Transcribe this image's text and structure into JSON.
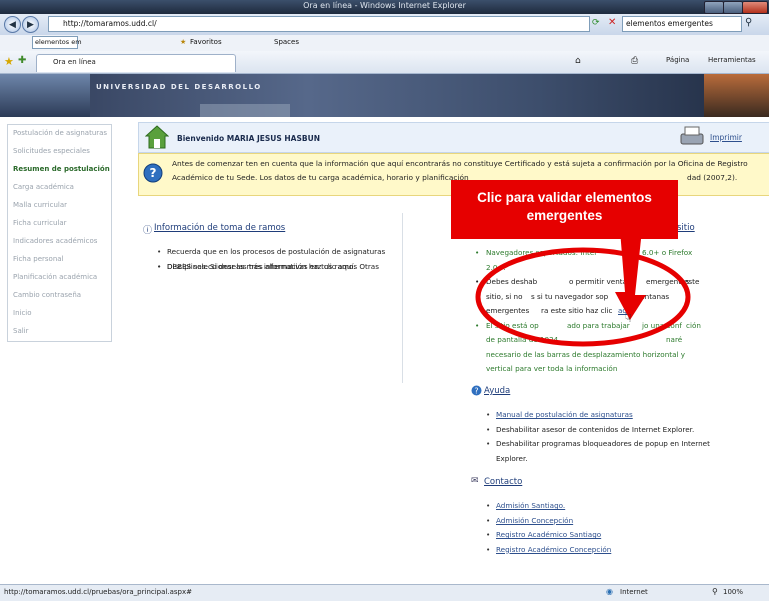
{
  "window": {
    "title": "Ora en línea - Windows Internet Explorer"
  },
  "address": {
    "url": "http://tomaramos.udd.cl/",
    "search": "elementos emergentes"
  },
  "links_bar": {
    "search_box": "elementos em",
    "favoritos": "Favoritos",
    "spaces": "Spaces"
  },
  "tab": {
    "title": "Ora en línea"
  },
  "tools": {
    "pagina": "Página",
    "herramientas": "Herramientas"
  },
  "banner": {
    "title": "UNIVERSIDAD DEL DESARROLLO"
  },
  "sidebar": {
    "items": [
      {
        "label": "Postulación de asignaturas"
      },
      {
        "label": "Solicitudes especiales"
      },
      {
        "label": "Resumen de postulación"
      },
      {
        "label": "Carga académica"
      },
      {
        "label": "Malla curricular"
      },
      {
        "label": "Ficha curricular"
      },
      {
        "label": "Indicadores académicos"
      },
      {
        "label": "Ficha personal"
      },
      {
        "label": "Planificación académica"
      },
      {
        "label": "Cambio contraseña"
      },
      {
        "label": "Inicio"
      },
      {
        "label": "Salir"
      }
    ]
  },
  "welcome": {
    "greeting": "Bienvenido MARIA JESUS HASBUN",
    "print": "Imprimir"
  },
  "notice": {
    "line1": "Antes de comenzar ten en cuenta que la información que aquí encontrarás no constituye Certificado y está sujeta a confirmación por la Oficina de Registro",
    "line2": "Académico de tu Sede. Los datos de tu carga académica, horario y planificación",
    "line2_end": "dad (2007,2)."
  },
  "info": {
    "title": "Información de toma de ramos",
    "lines": [
      "Recuerda que en los procesos de postulación de asignaturas",
      "DEBES seleccionar las tres alternativas en tus ramos Otras",
      "Disciplinas. Si deseas más información haz clic aquí."
    ]
  },
  "req": {
    "title_tail": "sitio",
    "b1": [
      "Navegadores soportados: Inter",
      "6.0+ o Firefox",
      "2.0+."
    ],
    "b2": [
      "Debes deshab",
      "o permitir venta",
      "emergentes",
      "este",
      "sitio, si no",
      "s si tu navegador sop",
      "ventanas",
      "emergentes",
      "ra este sitio haz clic",
      "aq"
    ],
    "b3": [
      "El sitio está op",
      "ado para trabajar",
      "jo una conf",
      "ción",
      "de pantalla de 1024",
      "naré",
      "necesario de las barras de desplazamiento horizontal y",
      "vertical para ver toda la información"
    ]
  },
  "help": {
    "title": "Ayuda",
    "items": [
      "Manual de postulación de asignaturas",
      "Deshabilitar asesor de contenidos de Internet Explorer.",
      "Deshabilitar programas bloqueadores de popup en Internet",
      "Explorer."
    ]
  },
  "contact": {
    "title": "Contacto",
    "items": [
      "Admisión Santiago.",
      "Admisión Concepción",
      "Registro Académico Santiago",
      "Registro Académico Concepción"
    ]
  },
  "callout": {
    "line1": "Clic para validar elementos",
    "line2": "emergentes"
  },
  "status": {
    "url": "http://tomaramos.udd.cl/pruebas/ora_principal.aspx#",
    "zone": "Internet",
    "zoom": "100%"
  },
  "colors": {
    "accent_red": "#e60000",
    "nav_green": "#2b6a2b",
    "link_blue": "#2d4f8d",
    "notice_yellow": "#fff9c9"
  }
}
